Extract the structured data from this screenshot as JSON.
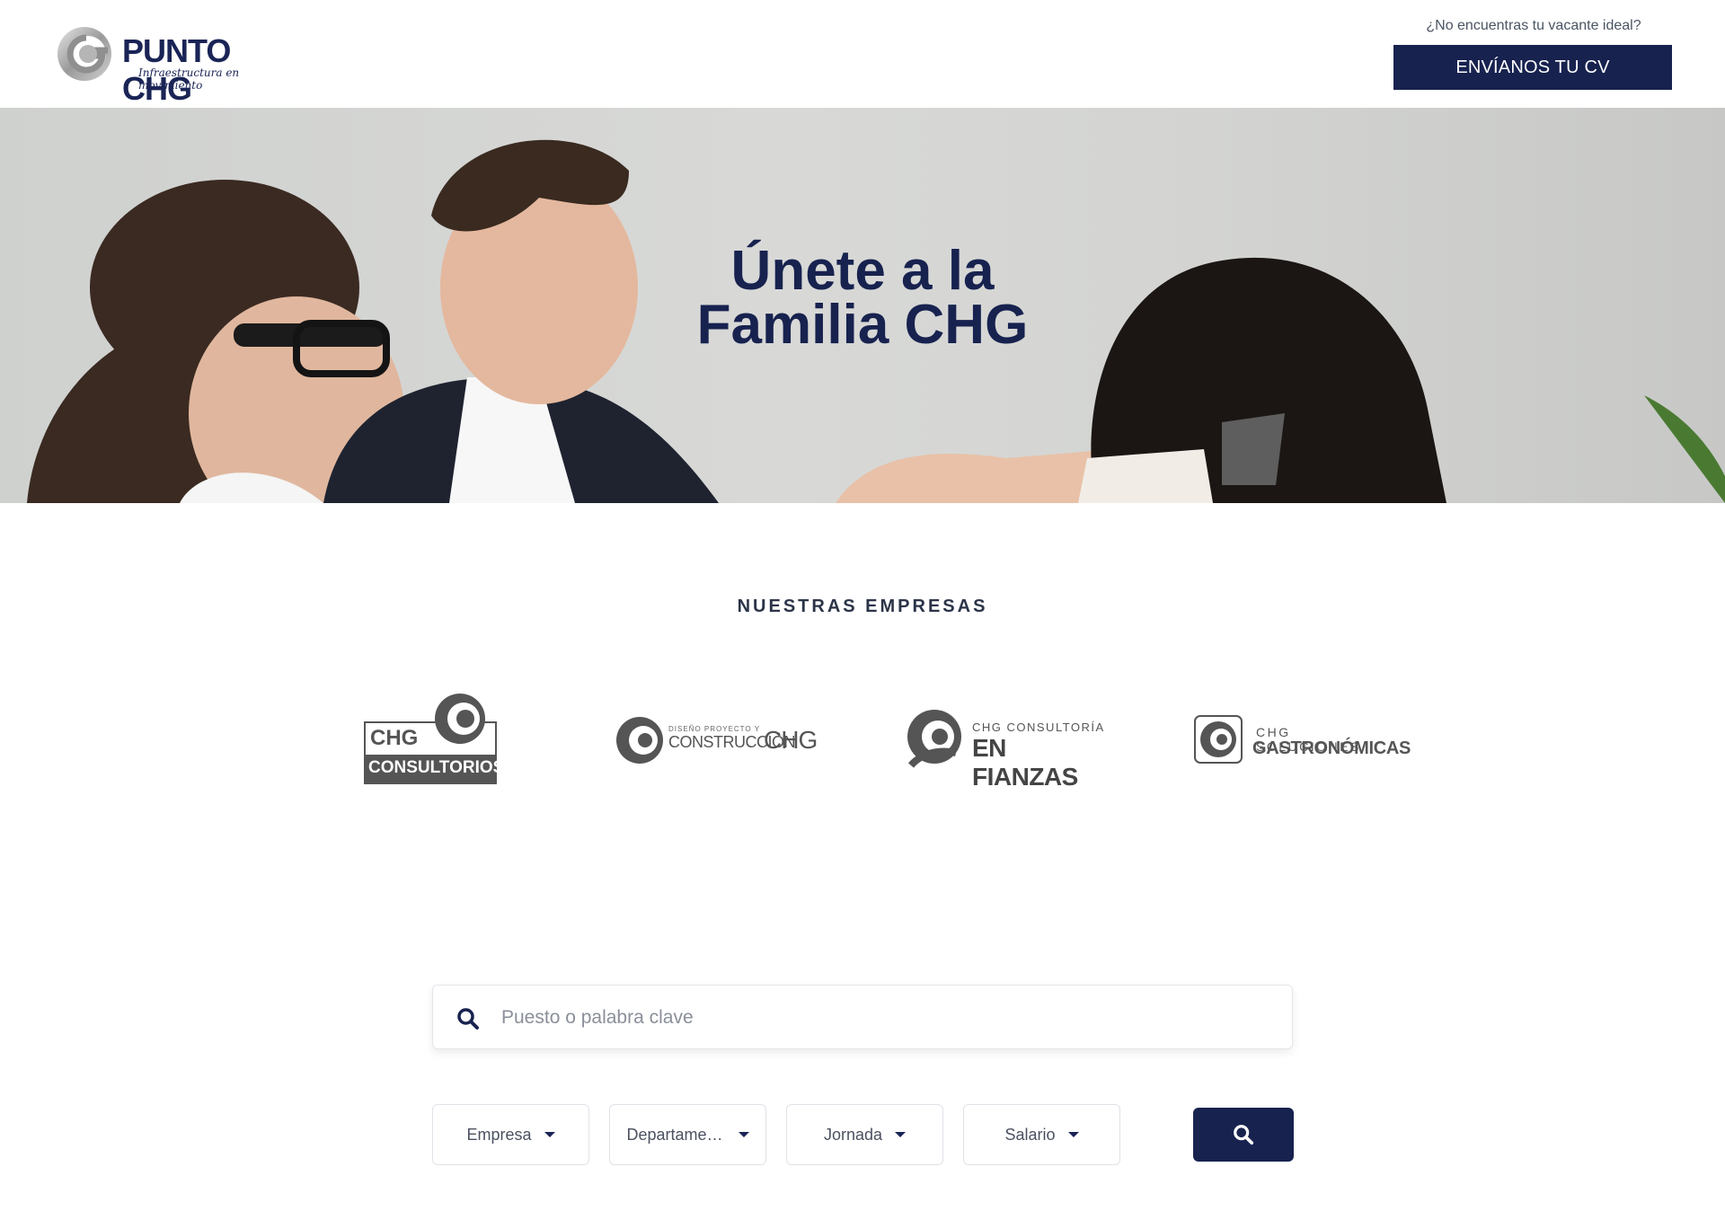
{
  "header": {
    "logo": {
      "name": "PUNTO CHG",
      "tagline": "Infraestructura en movimiento"
    },
    "cv_prompt": "¿No encuentras tu vacante ideal?",
    "cv_button": "ENVÍANOS TU CV"
  },
  "hero": {
    "title_line1": "Únete a la",
    "title_line2": "Familia CHG"
  },
  "companies": {
    "title": "NUESTRAS EMPRESAS",
    "items": [
      {
        "line1": "CHG",
        "line2": "CONSULTORIOS"
      },
      {
        "small": "DISEÑO PROYECTO Y",
        "main": "CONSTRUCCIÓN",
        "suffix": "CHG"
      },
      {
        "small": "CHG CONSULTORÍA",
        "main": "EN FIANZAS"
      },
      {
        "small": "CHG SOLUCIONES",
        "main": "GASTRONÓMICAS"
      }
    ]
  },
  "search": {
    "placeholder": "Puesto o palabra clave",
    "value": ""
  },
  "filters": [
    {
      "label": "Empresa"
    },
    {
      "label": "Departamento"
    },
    {
      "label": "Jornada"
    },
    {
      "label": "Salario"
    }
  ],
  "icons": {
    "search": "search-icon",
    "caret": "caret-down-icon"
  },
  "colors": {
    "brand_navy": "#17224f",
    "text_gray": "#4b5563"
  }
}
